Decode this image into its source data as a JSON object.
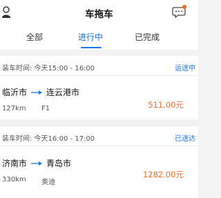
{
  "header": {
    "title": "车拖车",
    "user_icon": "user-icon",
    "chat_icon": "chat-bubble-icon",
    "notification_color": "#f36b21"
  },
  "tabs": [
    {
      "label": "全部",
      "active": false
    },
    {
      "label": "进行中",
      "active": true
    },
    {
      "label": "已完成",
      "active": false
    }
  ],
  "orders": [
    {
      "time": "装车时间: 今天15:00 - 16:00",
      "status": "运送中",
      "from": "临沂市",
      "to": "连云港市",
      "distance": "127km",
      "model": "F1",
      "price": "511.00元"
    },
    {
      "time": "装车时间: 今天16:00 - 17:00",
      "status": "已送达",
      "from": "济南市",
      "to": "青岛市",
      "distance": "330km",
      "model": "奥迪",
      "price": "1282.00元"
    }
  ],
  "colors": {
    "accent": "#1a73e8",
    "price": "#f36b21"
  }
}
